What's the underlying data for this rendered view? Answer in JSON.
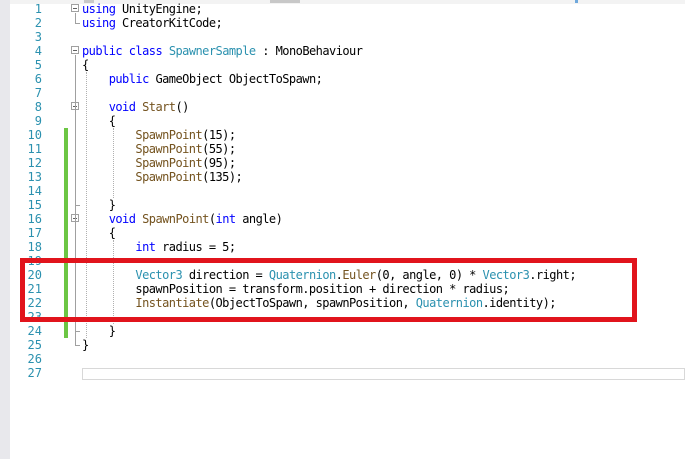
{
  "editor": {
    "lines": [
      {
        "n": "1",
        "text": "using UnityEngine;"
      },
      {
        "n": "2",
        "text": "using CreatorKitCode;"
      },
      {
        "n": "3",
        "text": ""
      },
      {
        "n": "4",
        "text": "public class SpawnerSample : MonoBehaviour"
      },
      {
        "n": "5",
        "text": "{"
      },
      {
        "n": "6",
        "text": "    public GameObject ObjectToSpawn;"
      },
      {
        "n": "7",
        "text": ""
      },
      {
        "n": "8",
        "text": "    void Start()"
      },
      {
        "n": "9",
        "text": "    {"
      },
      {
        "n": "10",
        "text": "        SpawnPoint(15);"
      },
      {
        "n": "11",
        "text": "        SpawnPoint(55);"
      },
      {
        "n": "12",
        "text": "        SpawnPoint(95);"
      },
      {
        "n": "13",
        "text": "        SpawnPoint(135);"
      },
      {
        "n": "14",
        "text": ""
      },
      {
        "n": "15",
        "text": "    }"
      },
      {
        "n": "16",
        "text": "    void SpawnPoint(int angle)"
      },
      {
        "n": "17",
        "text": "    {"
      },
      {
        "n": "18",
        "text": "        int radius = 5;"
      },
      {
        "n": "19",
        "text": ""
      },
      {
        "n": "20",
        "text": "        Vector3 direction = Quaternion.Euler(0, angle, 0) * Vector3.right;"
      },
      {
        "n": "21",
        "text": "        spawnPosition = transform.position + direction * radius;"
      },
      {
        "n": "22",
        "text": "        Instantiate(ObjectToSpawn, spawnPosition, Quaternion.identity);"
      },
      {
        "n": "23",
        "text": ""
      },
      {
        "n": "24",
        "text": "    }"
      },
      {
        "n": "25",
        "text": "}"
      },
      {
        "n": "26",
        "text": ""
      },
      {
        "n": "27",
        "text": ""
      }
    ]
  },
  "colors": {
    "keyword": "#0000ff",
    "type": "#2b91af",
    "method": "#74531f",
    "line_number": "#2b91af",
    "change_marker": "#6cc644",
    "highlight_box": "#e1141c"
  },
  "icons": {
    "fold": "collapse-minus-icon"
  }
}
